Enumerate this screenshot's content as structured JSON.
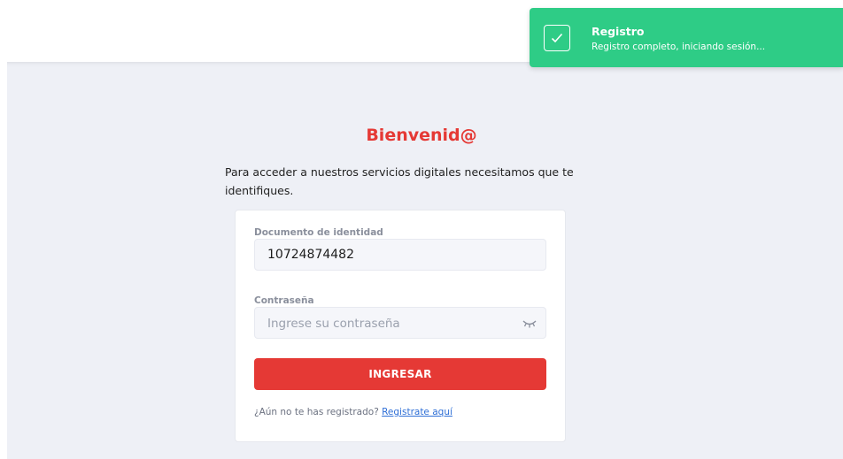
{
  "toast": {
    "title": "Registro",
    "message": "Registro completo, iniciando sesión...",
    "icon": "check-icon",
    "color": "#2ecc86"
  },
  "login": {
    "title": "Bienvenid@",
    "intro": "Para acceder a nuestros servicios digitales necesitamos que te identifiques.",
    "document_label": "Documento de identidad",
    "document_value": "10724874482",
    "password_label": "Contraseña",
    "password_placeholder": "Ingrese su contraseña",
    "password_icon": "eye-closed-icon",
    "submit_label": "INGRESAR",
    "register_prompt": "¿Aún no te has registrado?",
    "register_link": "Registrate aquí"
  },
  "colors": {
    "accent": "#e53935",
    "link": "#2f6fd6",
    "background": "#eef0f6"
  }
}
